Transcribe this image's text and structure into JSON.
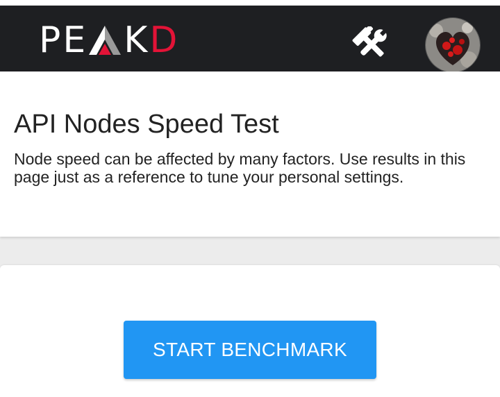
{
  "header": {
    "logo": {
      "p": "P",
      "e": "E",
      "k": "K",
      "d": "D"
    },
    "tools_icon": "hammer-wrench-icon",
    "avatar": "user-avatar"
  },
  "page": {
    "title": "API Nodes Speed Test",
    "description": "Node speed can be affected by many factors. Use results in this page just as a reference to tune your personal settings."
  },
  "actions": {
    "start_label": "START BENCHMARK"
  },
  "colors": {
    "header_bg": "#1e1f22",
    "brand_red": "#e31337",
    "button_blue": "#2196f3",
    "page_bg": "#ececec"
  }
}
